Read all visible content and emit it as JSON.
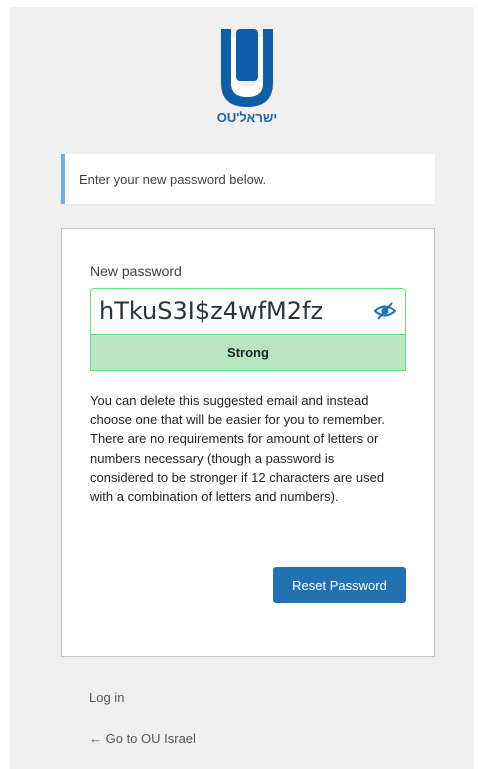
{
  "logo": {
    "text": "OU'ישראל",
    "icon": "ou-logo-icon",
    "brand_color": "#0e5fa8"
  },
  "message": {
    "text": "Enter your new password below.",
    "accent_color": "#72aee6"
  },
  "form": {
    "password_label": "New password",
    "password_value": "hTkuS3I$z4wfM2fz",
    "toggle_icon": "eye-slash-icon",
    "strength_label": "Strong",
    "strength_color": "#b8e6bf",
    "hint_text": "You can delete this suggested email and instead choose one that will be easier for you to remember. There are no requirements for amount of letters or numbers necessary (though a password is considered to be stronger if 12 characters are used with a combination of letters and numbers).",
    "submit_label": "Reset Password",
    "submit_color": "#2271b1"
  },
  "nav": {
    "login_label": "Log in",
    "back_label": "← Go to OU Israel"
  }
}
